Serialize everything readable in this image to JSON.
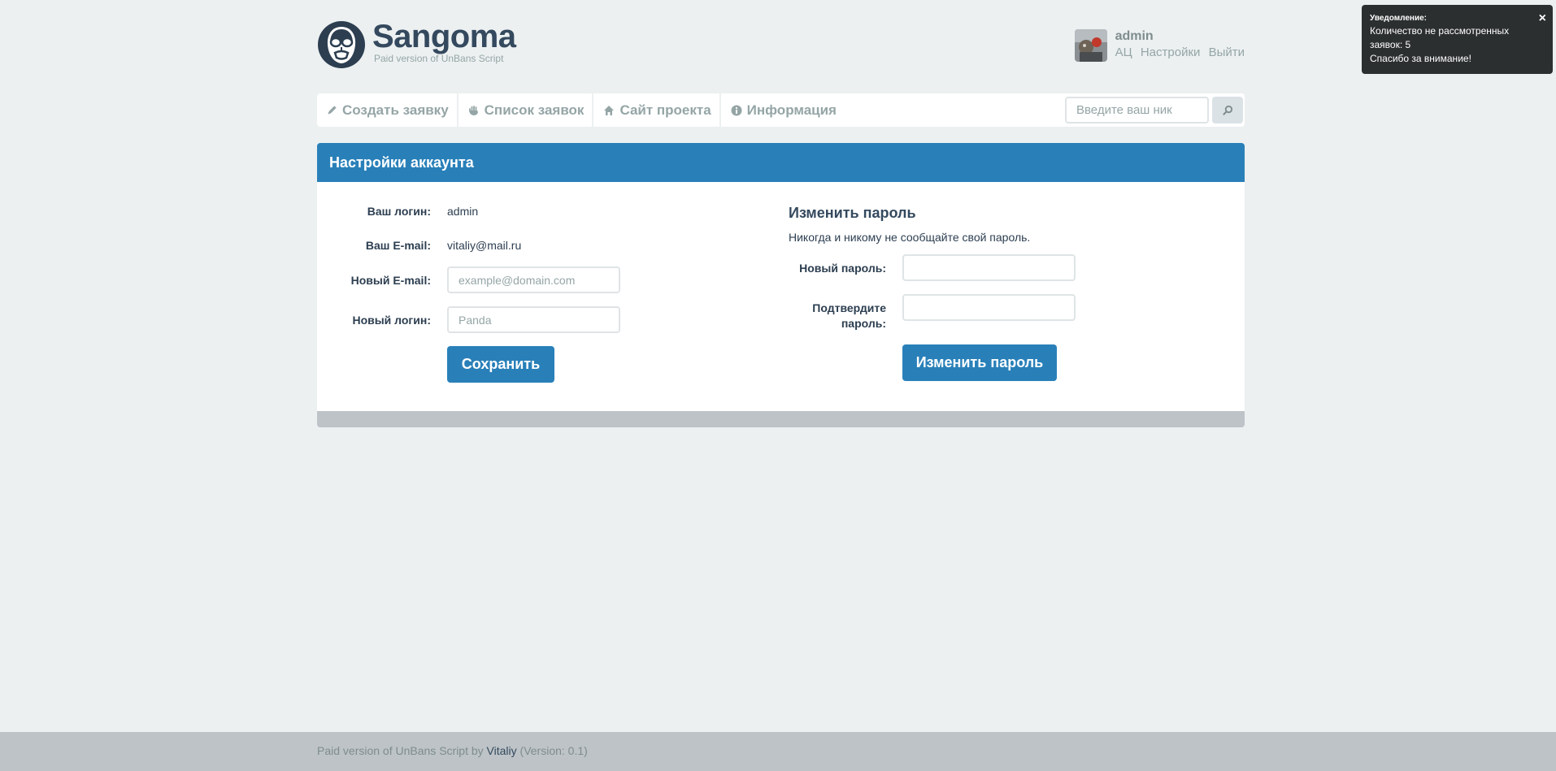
{
  "brand": {
    "title": "Sangoma",
    "subtitle": "Paid version of UnBans Script"
  },
  "user": {
    "name": "admin",
    "links": [
      "АЦ",
      "Настройки",
      "Выйти"
    ]
  },
  "nav": {
    "items": [
      {
        "label": "Создать заявку",
        "icon": "pencil-icon"
      },
      {
        "label": "Список заявок",
        "icon": "hand-icon"
      },
      {
        "label": "Сайт проекта",
        "icon": "home-icon"
      },
      {
        "label": "Информация",
        "icon": "info-icon"
      }
    ],
    "search_placeholder": "Введите ваш ник"
  },
  "panel": {
    "title": "Настройки аккаунта",
    "account": {
      "login_label": "Ваш логин:",
      "login_value": "admin",
      "email_label": "Ваш E-mail:",
      "email_value": "vitaliy@mail.ru",
      "new_email_label": "Новый E-mail:",
      "new_email_placeholder": "example@domain.com",
      "new_login_label": "Новый логин:",
      "new_login_placeholder": "Panda",
      "save_label": "Сохранить"
    },
    "password": {
      "title": "Изменить пароль",
      "note": "Никогда и никому не сообщайте свой пароль.",
      "new_label": "Новый пароль:",
      "confirm_label_1": "Подтвердите",
      "confirm_label_2": "пароль:",
      "button_label": "Изменить пароль"
    }
  },
  "footer": {
    "prefix": "Paid version of UnBans Script by",
    "author": "Vitaliy",
    "version": "(Version: 0.1)"
  },
  "toast": {
    "title": "Уведомление:",
    "line1": "Количество не рассмотренных",
    "line2": "заявок: 5",
    "line3": "Спасибо за внимание!",
    "close": "×"
  },
  "colors": {
    "primary": "#2980b9",
    "background": "#ecf0f1",
    "muted": "#95a5a6"
  }
}
